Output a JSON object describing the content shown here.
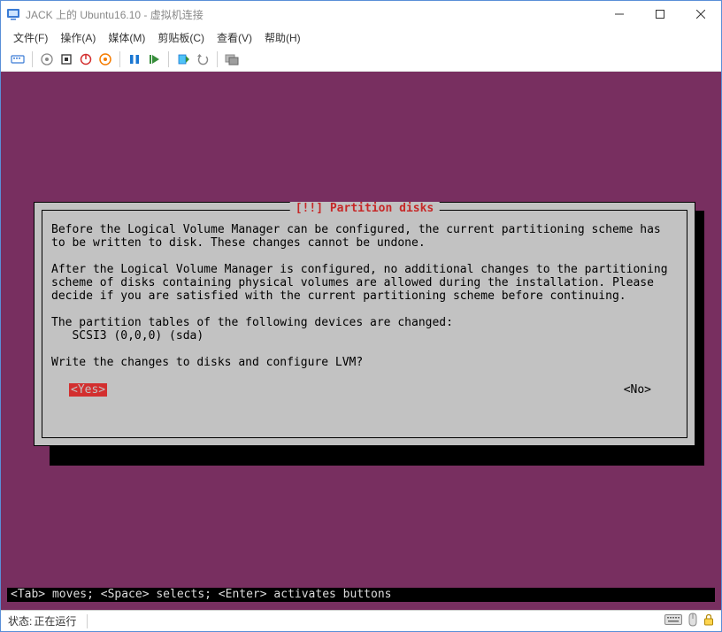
{
  "window": {
    "title": "JACK 上的 Ubuntu16.10 - 虚拟机连接"
  },
  "menu": {
    "file": "文件(F)",
    "action": "操作(A)",
    "media": "媒体(M)",
    "clipboard": "剪贴板(C)",
    "view": "查看(V)",
    "help": "帮助(H)"
  },
  "installer": {
    "title": "[!!] Partition disks",
    "para1": "Before the Logical Volume Manager can be configured, the current partitioning scheme has to be written to disk. These changes cannot be undone.",
    "para2": "After the Logical Volume Manager is configured, no additional changes to the partitioning scheme of disks containing physical volumes are allowed during the installation. Please decide if you are satisfied with the current partitioning scheme before continuing.",
    "para3": "The partition tables of the following devices are changed:",
    "device": "   SCSI3 (0,0,0) (sda)",
    "question": "Write the changes to disks and configure LVM?",
    "yes": "<Yes>",
    "no": "<No>"
  },
  "hint": "<Tab> moves; <Space> selects; <Enter> activates buttons",
  "status": {
    "label": "状态:",
    "value": "正在运行"
  }
}
